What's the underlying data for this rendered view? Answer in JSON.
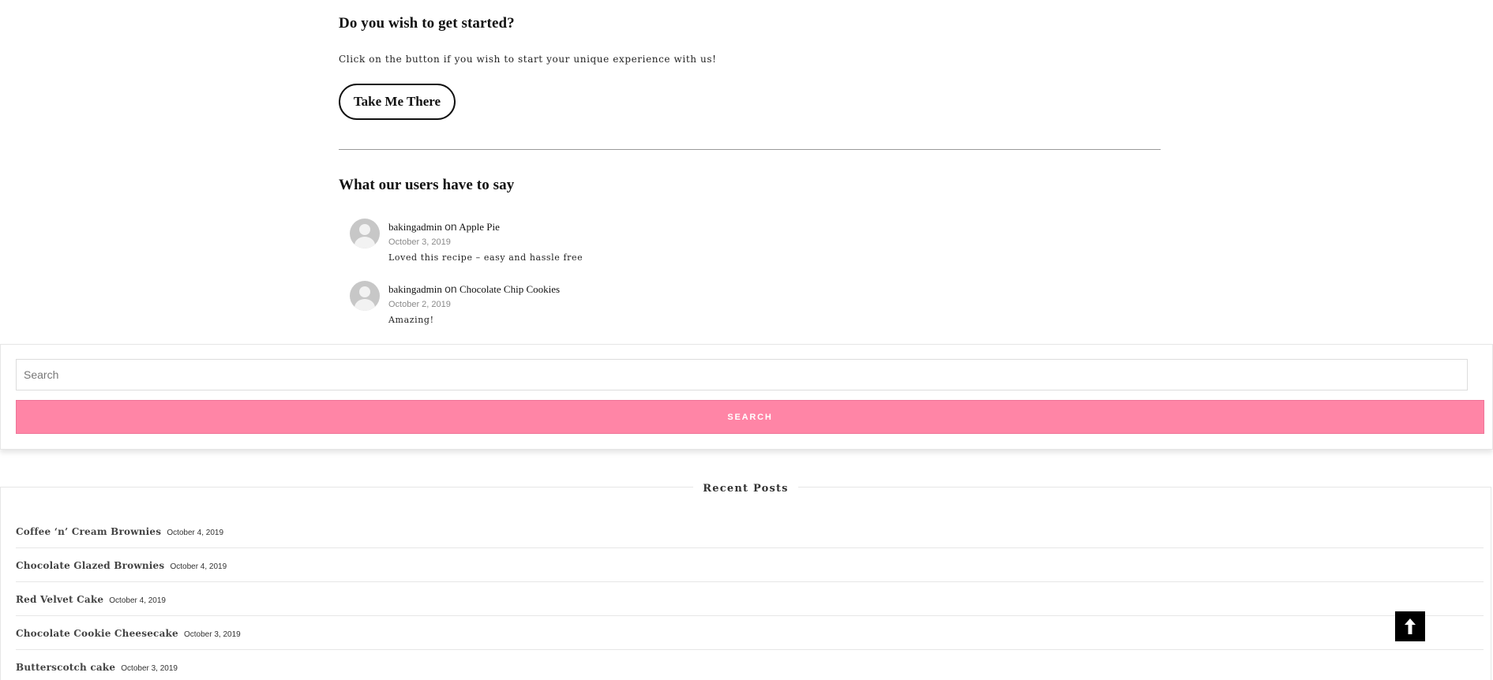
{
  "cta_section": {
    "heading": "Do you wish to get started?",
    "text": "Click on the button if you wish to start your unique experience with us!",
    "button_label": "Take Me There"
  },
  "testimonials": {
    "heading": "What our users have to say",
    "on_word": "on",
    "comments": [
      {
        "author": "bakingadmin",
        "post": "Apple Pie",
        "date": "October 3, 2019",
        "text": "Loved this recipe – easy and hassle free"
      },
      {
        "author": "bakingadmin",
        "post": "Chocolate Chip Cookies",
        "date": "October 2, 2019",
        "text": "Amazing!"
      }
    ]
  },
  "search": {
    "placeholder": "Search",
    "value": "",
    "button_label": "SEARCH"
  },
  "recent_posts": {
    "title": "Recent Posts",
    "items": [
      {
        "title": "Coffee ‘n’ Cream Brownies",
        "date": "October 4, 2019"
      },
      {
        "title": "Chocolate Glazed Brownies",
        "date": "October 4, 2019"
      },
      {
        "title": "Red Velvet Cake",
        "date": "October 4, 2019"
      },
      {
        "title": "Chocolate Cookie Cheesecake",
        "date": "October 3, 2019"
      },
      {
        "title": "Butterscotch cake",
        "date": "October 3, 2019"
      }
    ]
  },
  "colors": {
    "search_button": "#ff85a6",
    "text": "#111111",
    "date_gray": "#8a8a8a"
  },
  "icons": {
    "back_to_top": "arrow-up-icon",
    "avatar": "default-avatar-icon"
  }
}
